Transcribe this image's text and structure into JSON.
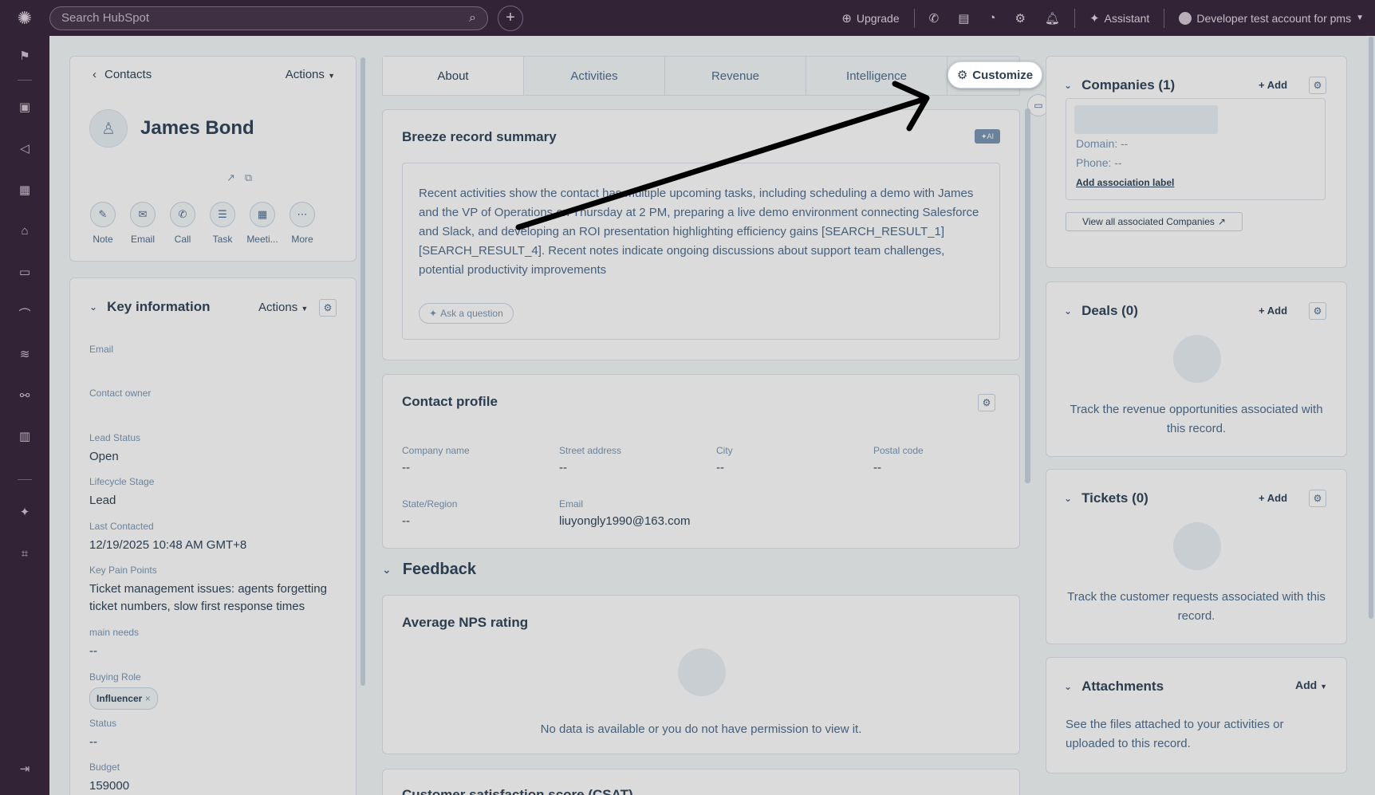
{
  "topbar": {
    "search_placeholder": "Search HubSpot",
    "upgrade": "Upgrade",
    "assistant": "Assistant",
    "account": "Developer test account for pms"
  },
  "header": {
    "back_label": "Contacts",
    "actions_label": "Actions",
    "contact_name": "James Bond",
    "quick_actions": [
      "Note",
      "Email",
      "Call",
      "Task",
      "Meeti...",
      "More"
    ]
  },
  "key_info": {
    "title": "Key information",
    "actions_label": "Actions",
    "props": [
      {
        "label": "Email",
        "value": ""
      },
      {
        "label": "Contact owner",
        "value": ""
      },
      {
        "label": "Lead Status",
        "value": "Open"
      },
      {
        "label": "Lifecycle Stage",
        "value": "Lead"
      },
      {
        "label": "Last Contacted",
        "value": "12/19/2025 10:48 AM GMT+8"
      },
      {
        "label": "Key Pain Points",
        "value": "Ticket management issues: agents forgetting ticket numbers, slow first response times"
      },
      {
        "label": "main needs",
        "value": "--"
      },
      {
        "label": "Buying Role",
        "value": "Influencer"
      },
      {
        "label": "Status",
        "value": "--"
      },
      {
        "label": "Budget",
        "value": "159000"
      }
    ]
  },
  "tabs": [
    "About",
    "Activities",
    "Revenue",
    "Intelligence"
  ],
  "customize_label": "Customize",
  "summary": {
    "title": "Breeze record summary",
    "ai_badge": "AI",
    "text": "Recent activities show the contact has multiple upcoming tasks, including scheduling a demo with James and the VP of Operations on Thursday at 2 PM, preparing a live demo environment connecting Salesforce and Slack, and developing an ROI presentation highlighting efficiency gains [SEARCH_RESULT_1] [SEARCH_RESULT_4]. Recent notes indicate ongoing discussions about support team challenges, potential productivity improvements",
    "ask_label": "Ask a question"
  },
  "profile": {
    "title": "Contact profile",
    "fields": [
      {
        "label": "Company name",
        "value": "--"
      },
      {
        "label": "Street address",
        "value": "--"
      },
      {
        "label": "City",
        "value": "--"
      },
      {
        "label": "Postal code",
        "value": "--"
      },
      {
        "label": "State/Region",
        "value": "--"
      },
      {
        "label": "Email",
        "value": "liuyongly1990@163.com"
      }
    ]
  },
  "feedback": {
    "title": "Feedback",
    "nps_title": "Average NPS rating",
    "nps_empty": "No data is available or you do not have permission to view it.",
    "csat_title": "Customer satisfaction score (CSAT)"
  },
  "right": {
    "companies_title": "Companies (1)",
    "add_label": "Add",
    "domain": "Domain: --",
    "phone": "Phone: --",
    "assoc_label": "Add association label",
    "view_all": "View all associated Companies",
    "deals_title": "Deals (0)",
    "deals_empty": "Track the revenue opportunities associated with this record.",
    "tickets_title": "Tickets (0)",
    "tickets_empty": "Track the customer requests associated with this record.",
    "attachments_title": "Attachments",
    "attachments_add": "Add",
    "attachments_text": "See the files attached to your activities or uploaded to this record."
  }
}
